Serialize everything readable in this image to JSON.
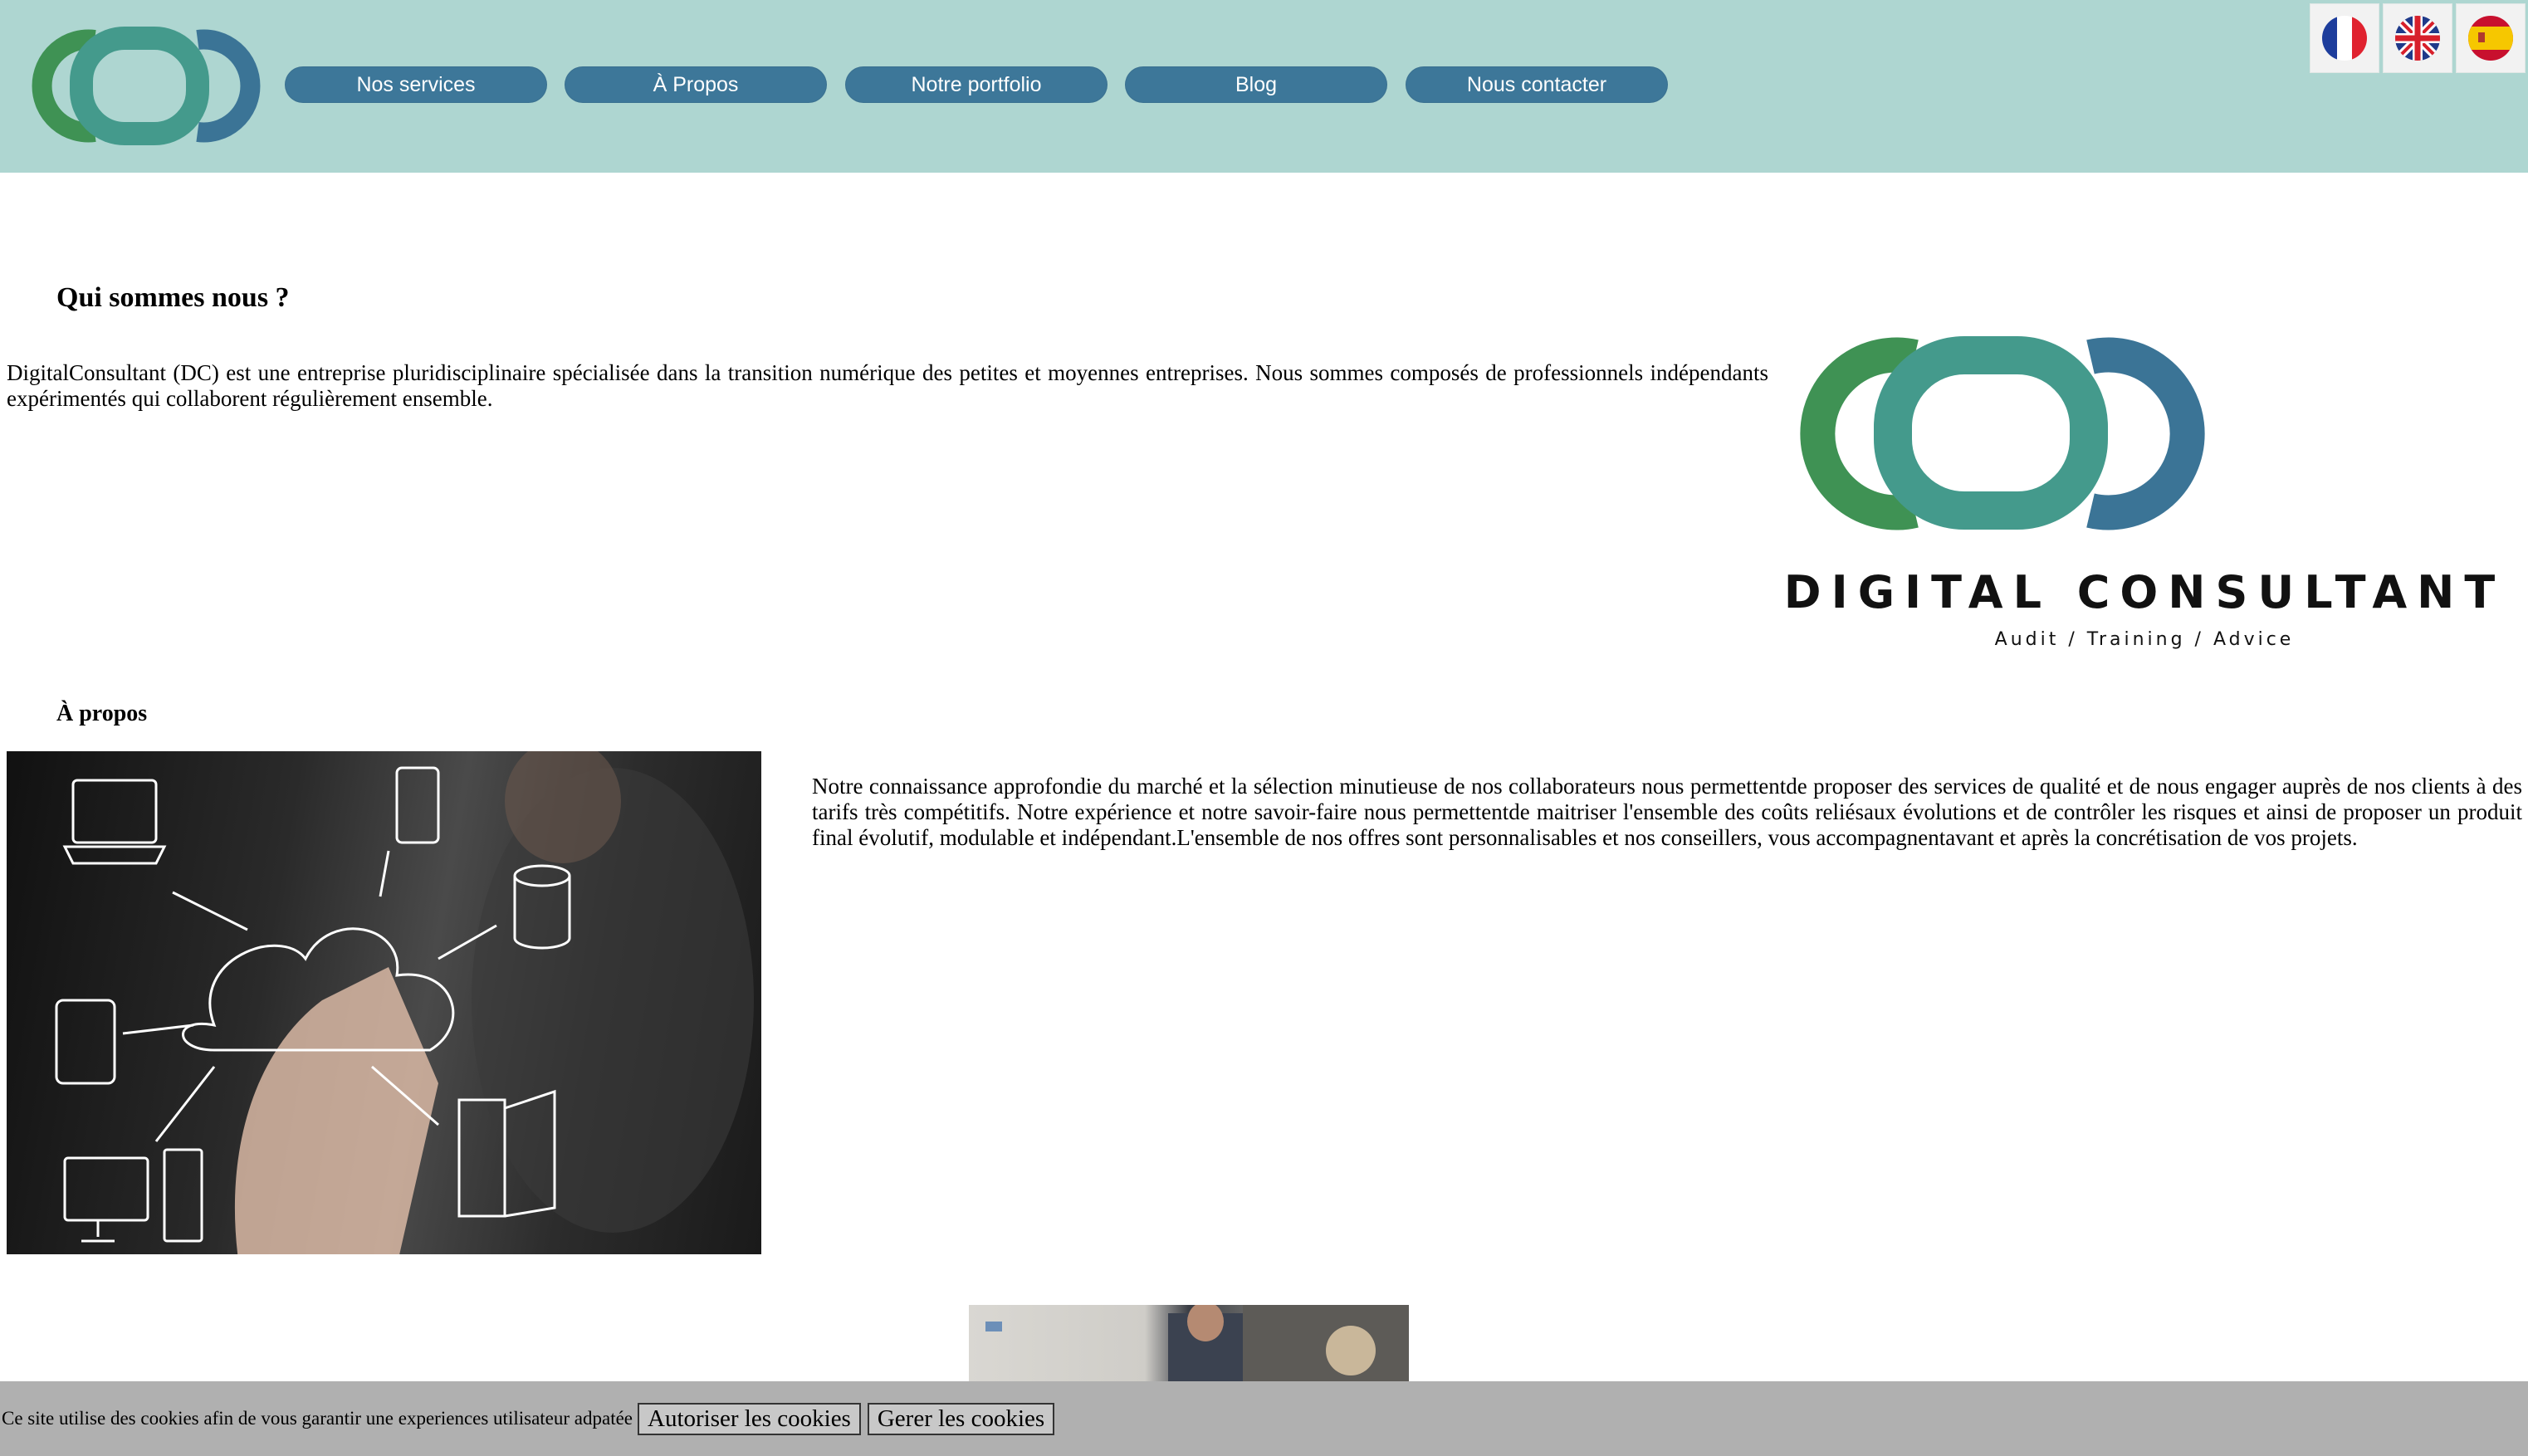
{
  "header": {
    "nav": [
      {
        "label": "Nos services"
      },
      {
        "label": "À Propos"
      },
      {
        "label": "Notre portfolio"
      },
      {
        "label": "Blog"
      },
      {
        "label": "Nous contacter"
      }
    ],
    "languages": [
      {
        "icon": "france-flag-icon"
      },
      {
        "icon": "uk-flag-icon"
      },
      {
        "icon": "spain-flag-icon"
      }
    ]
  },
  "intro": {
    "title": "Qui sommes nous ?",
    "text": "DigitalConsultant (DC) est une entreprise pluridisciplinaire spécialisée dans la transition numérique des petites et moyennes entreprises. Nous sommes composés de professionnels indépendants expérimentés qui collaborent régulièrement ensemble."
  },
  "brand": {
    "name": "DIGITAL CONSULTANT",
    "tagline": "Audit / Training / Advice",
    "colors": {
      "green": "#3f9254",
      "teal": "#449a8c",
      "blue": "#3b7496"
    }
  },
  "about": {
    "title": "À propos",
    "text": "Notre connaissance approfondie du marché et la sélection minutieuse de nos collaborateurs nous permettentde proposer des services de qualité et de nous engager auprès de nos clients à des tarifs très compétitifs. Notre expérience et notre savoir-faire nous permettentde maitriser l'ensemble des coûts reliésaux évolutions et de contrôler les risques et ainsi de proposer un produit final évolutif, modulable et indépendant.L'ensemble de nos offres sont personnalisables et nos conseillers, vous accompagnentavant et après la concrétisation de vos projets."
  },
  "cookie": {
    "text": "Ce site utilise des cookies afin de vous garantir une experiences utilisateur adpatée",
    "accept_label": "Autoriser les cookies",
    "manage_label": "Gerer les cookies"
  }
}
